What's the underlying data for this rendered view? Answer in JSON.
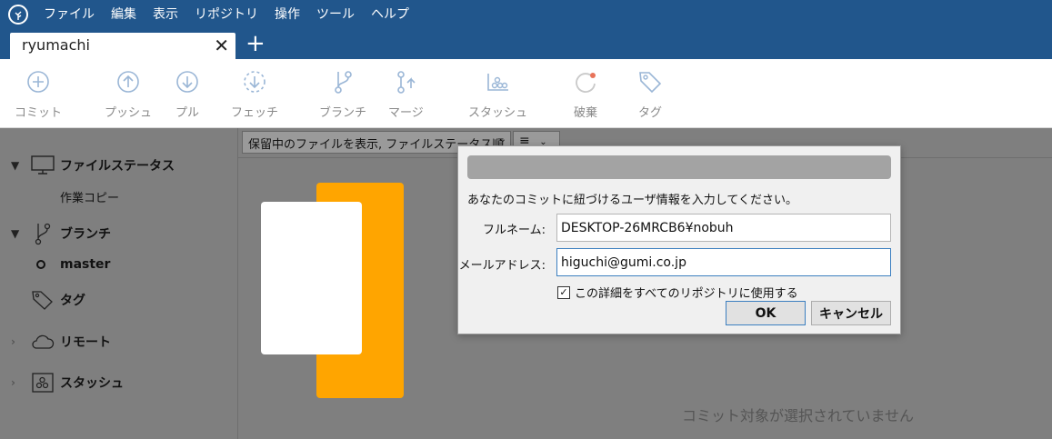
{
  "menubar": {
    "items": [
      "ファイル",
      "編集",
      "表示",
      "リポジトリ",
      "操作",
      "ツール",
      "ヘルプ"
    ]
  },
  "tab": {
    "title": "ryumachi",
    "close_glyph": "✕",
    "add_glyph": "+"
  },
  "toolbar": {
    "commit": "コミット",
    "push": "プッシュ",
    "pull": "プル",
    "fetch": "フェッチ",
    "branch": "ブランチ",
    "merge": "マージ",
    "stash": "スタッシュ",
    "discard": "破棄",
    "tag": "タグ"
  },
  "sidebar": {
    "file_status": "ファイルステータス",
    "working_copy": "作業コピー",
    "branches": "ブランチ",
    "master": "master",
    "tags": "タグ",
    "remotes": "リモート",
    "stashes": "スタッシュ"
  },
  "filter": {
    "selected": "保留中のファイルを表示, ファイルステータス順",
    "view_icon": "≡"
  },
  "main": {
    "empty_message": "コミット対象が選択されていません"
  },
  "dialog": {
    "prompt": "あなたのコミットに紐づけるユーザ情報を入力してください。",
    "fullname_label": "フルネーム:",
    "fullname_value": "DESKTOP-26MRCB6¥nobuh",
    "email_label": "メールアドレス:",
    "email_value": "higuchi@gumi.co.jp",
    "global_checkbox_label": "この詳細をすべてのリポジトリに使用する",
    "global_checked": true,
    "ok": "OK",
    "cancel": "キャンセル"
  },
  "colors": {
    "header": "#21568c",
    "accent_orange": "#ffa500",
    "toolbar_icon": "#9ab6d6"
  }
}
